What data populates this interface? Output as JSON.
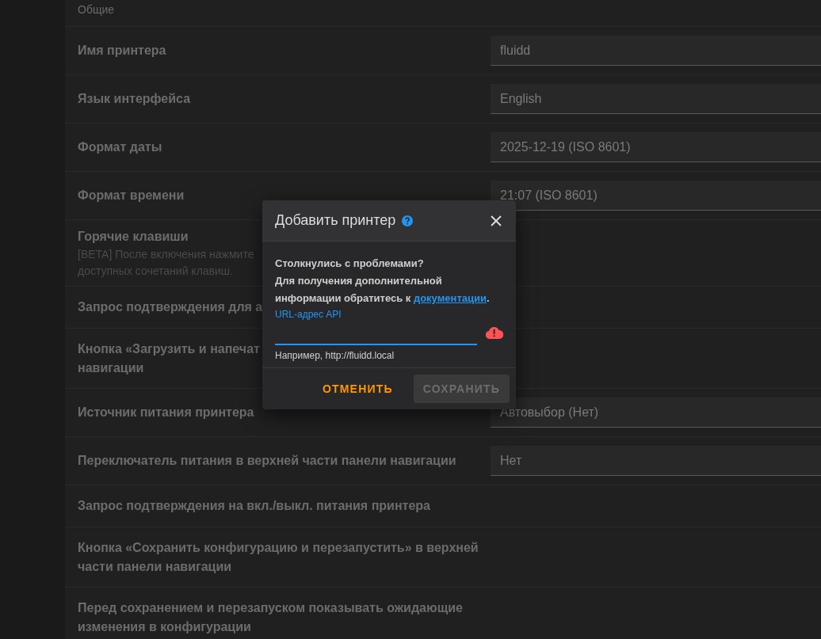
{
  "section_title": "Общие",
  "settings": [
    {
      "kind": "field",
      "label_lines": [
        "Имя принтера"
      ],
      "value": "fluidd"
    },
    {
      "kind": "field",
      "label_lines": [
        "Язык интерфейса"
      ],
      "value": "English"
    },
    {
      "kind": "field",
      "label_lines": [
        "Формат даты"
      ],
      "value": "2025-12-19 (ISO 8601)"
    },
    {
      "kind": "field",
      "label_lines": [
        "Формат времени"
      ],
      "value": "21:07 (ISO 8601)"
    },
    {
      "kind": "plain",
      "label_lines": [
        "Горячие клавиши"
      ],
      "description_lines": [
        "[BETA] После включения нажмите",
        "доступных сочетаний клавиш."
      ]
    },
    {
      "kind": "plain",
      "label_lines": [
        "Запрос подтверждения для а"
      ]
    },
    {
      "kind": "plain",
      "label_lines": [
        "Кнопка «Загрузить и напечат",
        "навигации"
      ]
    },
    {
      "kind": "field",
      "label_lines": [
        "Источник питания принтера"
      ],
      "value": "Автовыбор (Нет)"
    },
    {
      "kind": "field",
      "label_lines": [
        "Переключатель питания в верхней части панели навигации"
      ],
      "value": "Нет"
    },
    {
      "kind": "plain",
      "label_lines": [
        "Запрос подтверждения на вкл./выкл. питания принтера"
      ]
    },
    {
      "kind": "plain",
      "label_lines": [
        "Кнопка «Сохранить конфигурацию и перезапустить» в верхней",
        "части панели навигации"
      ]
    },
    {
      "kind": "plain",
      "label_lines": [
        "Перед сохранением и перезапуском показывать ожидающие",
        "изменения в конфигурации"
      ]
    }
  ],
  "dialog": {
    "title": "Добавить принтер",
    "message_lines": [
      "Столкнулись с проблемами?",
      "Для получения дополнительной",
      "информации обратитесь к"
    ],
    "link": "документации",
    "link_suffix": ".",
    "field": {
      "label": "URL-адрес API",
      "focused": true,
      "error": true,
      "hint": "Например, http://fluidd.local"
    },
    "buttons": [
      {
        "label": "ОТМЕНИТЬ",
        "kind": "text",
        "disabled": false
      },
      {
        "label": "СОХРАНИТЬ",
        "kind": "filled",
        "disabled": true
      }
    ]
  }
}
